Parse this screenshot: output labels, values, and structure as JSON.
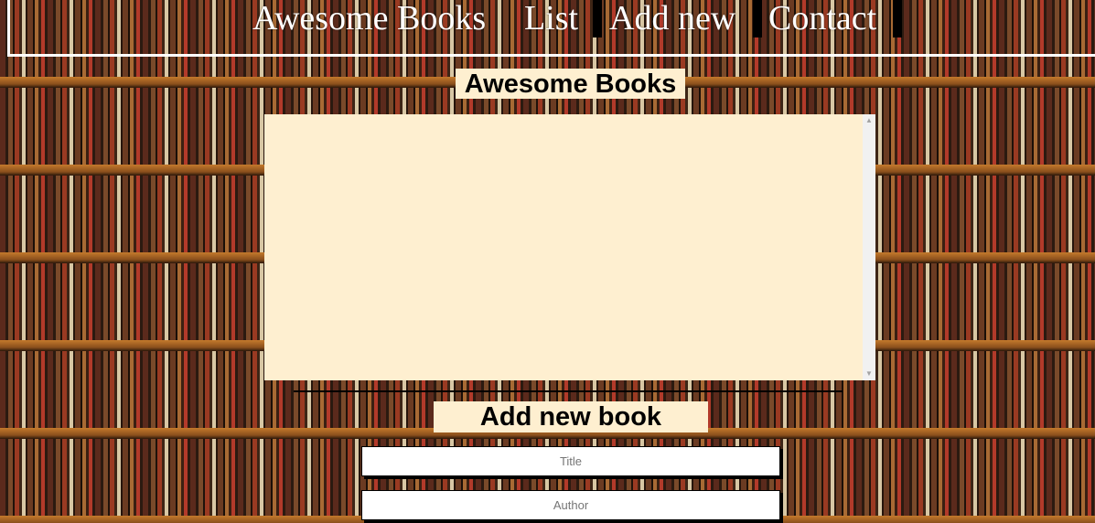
{
  "nav": {
    "brand": "Awesome Books",
    "items": [
      {
        "label": "List"
      },
      {
        "label": "Add new"
      },
      {
        "label": "Contact"
      }
    ]
  },
  "list_section": {
    "title": "Awesome Books",
    "books": []
  },
  "add_section": {
    "title": "Add new book",
    "title_placeholder": "Title",
    "author_placeholder": "Author"
  },
  "colors": {
    "panel_bg": "#feefd0",
    "nav_text": "#ffffff",
    "separator": "#000000"
  }
}
